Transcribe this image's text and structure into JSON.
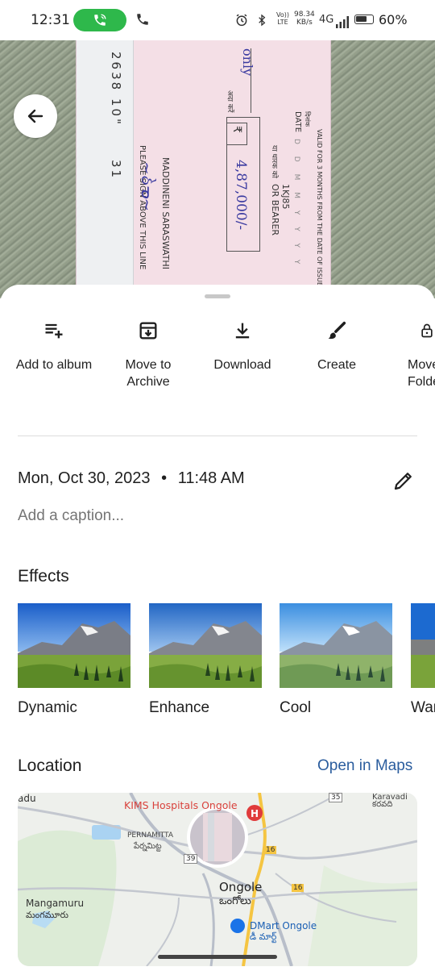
{
  "status_bar": {
    "time": "12:31",
    "network_speed_value": "98.34",
    "network_speed_unit": "KB/s",
    "volte": "Vo))",
    "lte": "LTE",
    "network_type": "4G",
    "battery": "60%",
    "battery_level": 0.6
  },
  "photo": {
    "cheque_validity": "VALID FOR 3 MONTHS FROM THE DATE OF ISSUE",
    "date_label": "DATE",
    "date_label_local": "दिनांक",
    "bearer_label": "OR BEARER",
    "bearer_label_local": "या धारक को",
    "cheque_code": "1KJ85",
    "date_format": "D D M M Y Y Y Y",
    "amount": "4,87,000/-",
    "rupee_symbol": "₹",
    "only_text": "only",
    "rupees_label": "अदा करें",
    "account_name": "MADDINENI SARASWATHI",
    "sign_line": "PLEASE SIGN ABOVE THIS LINE",
    "cheque_number_stub": "2638 10\"",
    "stub_digits": "31"
  },
  "actions": [
    {
      "label": "Add to album",
      "icon": "playlist-add-icon"
    },
    {
      "label": "Move to Archive",
      "icon": "archive-icon"
    },
    {
      "label": "Download",
      "icon": "download-icon"
    },
    {
      "label": "Create",
      "icon": "brush-icon"
    },
    {
      "label": "Move to Locked Folder",
      "icon": "lock-icon"
    }
  ],
  "details": {
    "date": "Mon, Oct 30, 2023",
    "separator": "•",
    "time": "11:48 AM",
    "caption_placeholder": "Add a caption..."
  },
  "effects": {
    "title": "Effects",
    "items": [
      {
        "name": "Dynamic"
      },
      {
        "name": "Enhance"
      },
      {
        "name": "Cool"
      },
      {
        "name": "Warm"
      }
    ]
  },
  "location": {
    "title": "Location",
    "open_maps": "Open in Maps",
    "map_labels": {
      "hospital": "KIMS Hospitals Ongole",
      "pernamitta": "PERNAMITTA",
      "pernamitta_local": "పేర్నమిట్ట",
      "ongole": "Ongole",
      "ongole_local": "ఒంగోలు",
      "mangamuru": "Mangamuru",
      "mangamuru_local": "మంగమూరు",
      "dmart": "DMart Ongole",
      "dmart_local": "డీ మార్ట్",
      "karavadi": "Karavadi",
      "karavadi_local": "కరవది",
      "adu": "adu",
      "highway_16": "16",
      "route_35": "35",
      "route_39": "39"
    }
  },
  "colors": {
    "accent_link": "#2b5d9e",
    "call_green": "#2eb84b",
    "hospital_red": "#e03b3b"
  }
}
